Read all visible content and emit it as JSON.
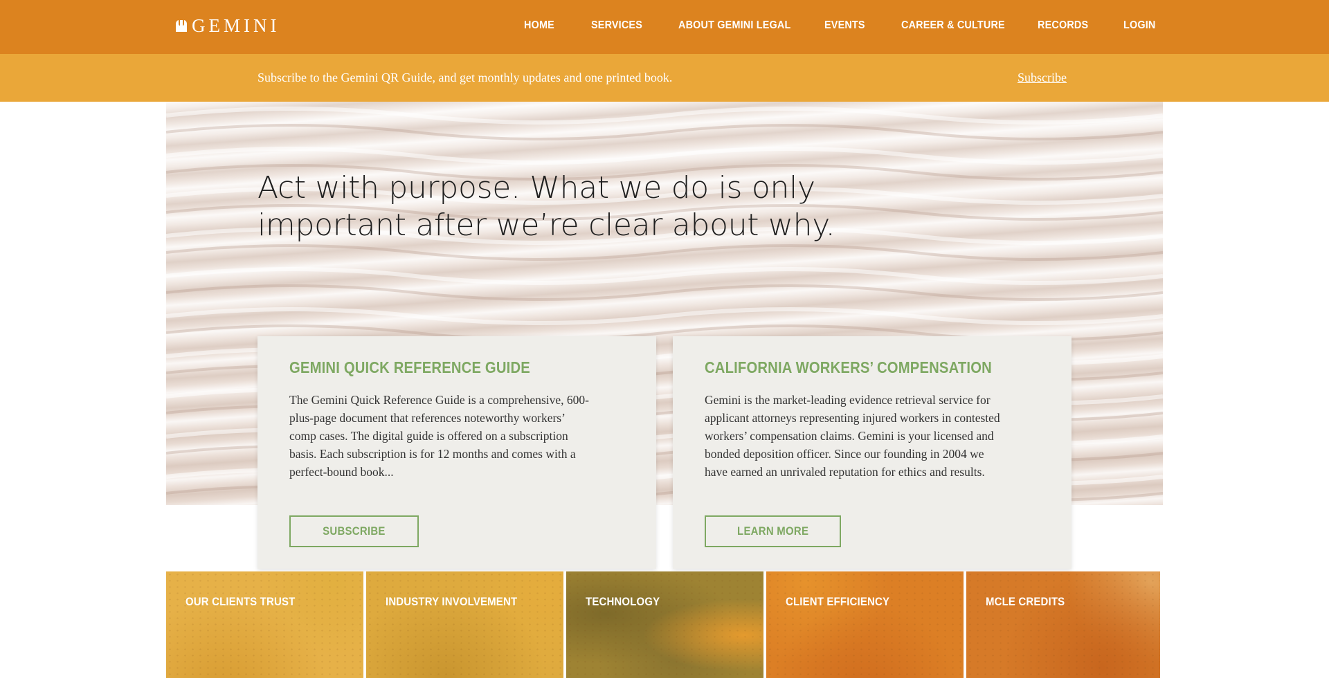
{
  "header": {
    "logo_text": "GEMINI",
    "nav": [
      {
        "label": "HOME"
      },
      {
        "label": "SERVICES"
      },
      {
        "label": "ABOUT GEMINI LEGAL"
      },
      {
        "label": "EVENTS"
      },
      {
        "label": "CAREER & CULTURE"
      },
      {
        "label": "RECORDS"
      },
      {
        "label": "LOGIN"
      }
    ]
  },
  "banner": {
    "text": "Subscribe to the Gemini QR Guide, and get monthly updates and one printed book.",
    "link": "Subscribe"
  },
  "hero": {
    "headline": "Act with purpose. What we do is only important after we’re clear about why."
  },
  "cards": [
    {
      "title": "GEMINI QUICK REFERENCE GUIDE",
      "body": "The Gemini Quick Reference Guide is a comprehensive, 600-plus-page document that references noteworthy workers’ comp cases. The digital guide is offered on a subscription basis. Each subscription is for 12 months and comes with a perfect-bound book...",
      "button": "SUBSCRIBE"
    },
    {
      "title": "CALIFORNIA WORKERS’ COMPENSATION",
      "body": "Gemini is the market-leading evidence retrieval service for applicant attorneys representing injured workers in contested workers’ compensation claims. Gemini is your licensed and bonded deposition officer. Since our founding in 2004 we have earned an unrivaled reputation for ethics and results.",
      "button": "LEARN MORE"
    }
  ],
  "tiles": [
    {
      "label": "OUR CLIENTS TRUST"
    },
    {
      "label": "INDUSTRY INVOLVEMENT"
    },
    {
      "label": "TECHNOLOGY"
    },
    {
      "label": "CLIENT EFFICIENCY"
    },
    {
      "label": "MCLE CREDITS"
    }
  ],
  "colors": {
    "nav_bg": "#dc831f",
    "banner_bg": "#eaa739",
    "accent_green": "#7ea862",
    "card_bg": "#efeeea"
  },
  "icons": [
    "gemini-logo-icon"
  ]
}
